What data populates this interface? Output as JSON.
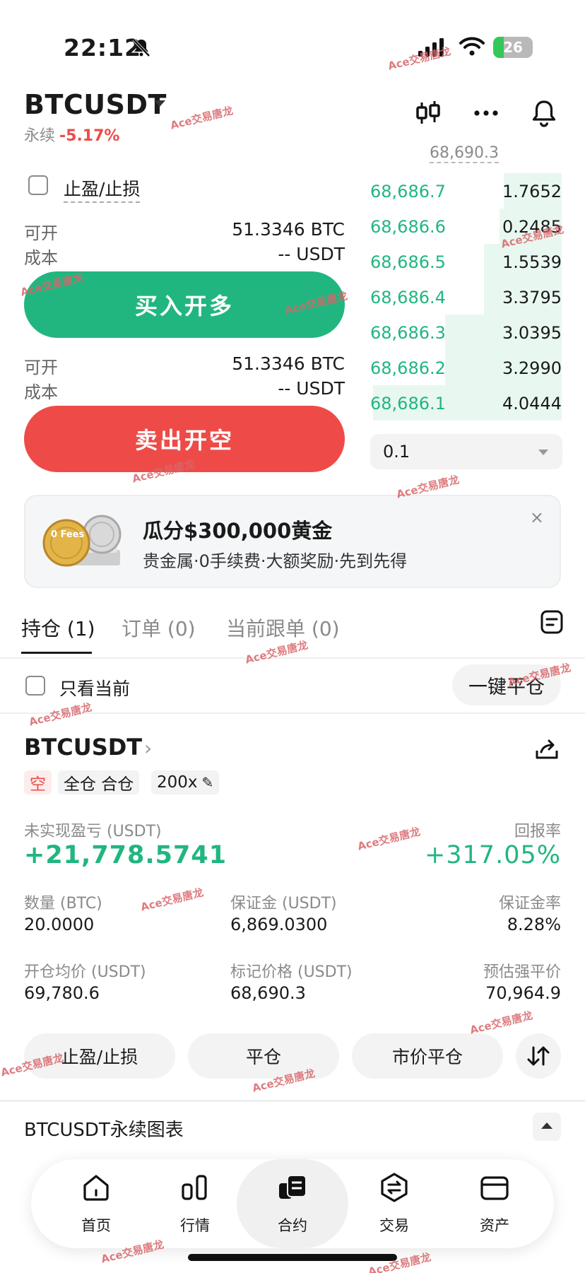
{
  "status_bar": {
    "time": "22:12",
    "battery": "26",
    "battery_level": 0.26
  },
  "header": {
    "symbol": "BTCUSDT",
    "contract_type": "永续",
    "change": "-5.17%",
    "last_price": "68,690.3"
  },
  "left_panel": {
    "tpsl_label": "止盈/止损",
    "long": {
      "avail_label": "可开",
      "avail_value": "51.3346 BTC",
      "cost_label": "成本",
      "cost_value": "-- USDT",
      "button": "买入开多"
    },
    "short": {
      "avail_label": "可开",
      "avail_value": "51.3346 BTC",
      "cost_label": "成本",
      "cost_value": "-- USDT",
      "button": "卖出开空"
    }
  },
  "order_book": {
    "rows": [
      {
        "price": "68,686.7",
        "qty": "1.7652"
      },
      {
        "price": "68,686.6",
        "qty": "0.2485"
      },
      {
        "price": "68,686.5",
        "qty": "1.5539"
      },
      {
        "price": "68,686.4",
        "qty": "3.3795"
      },
      {
        "price": "68,686.3",
        "qty": "3.0395"
      },
      {
        "price": "68,686.2",
        "qty": "3.2990"
      },
      {
        "price": "68,686.1",
        "qty": "4.0444"
      }
    ],
    "depth_fill": [
      0.3,
      0.32,
      0.4,
      0.4,
      0.6,
      0.6,
      0.97
    ],
    "step": "0.1"
  },
  "banner": {
    "title": "瓜分$300,000黄金",
    "subtitle": "贵金属·0手续费·大额奖励·先到先得",
    "close": "×",
    "coin_text": "0 Fees"
  },
  "tabs": [
    {
      "label": "持仓 (1)"
    },
    {
      "label": "订单 (0)"
    },
    {
      "label": "当前跟单 (0)"
    }
  ],
  "filter": {
    "only_current": "只看当前",
    "close_all": "一键平仓"
  },
  "position": {
    "symbol": "BTCUSDT",
    "side": "空",
    "margin_mode": "全仓 合仓",
    "leverage": "200x",
    "unrealized_label": "未实现盈亏 (USDT)",
    "unrealized_value": "+21,778.5741",
    "roe_label": "回报率",
    "roe_value": "+317.05%",
    "qty_label": "数量 (BTC)",
    "qty_value": "20.0000",
    "margin_label": "保证金 (USDT)",
    "margin_value": "6,869.0300",
    "margin_ratio_label": "保证金率",
    "margin_ratio_value": "8.28%",
    "entry_label": "开仓均价 (USDT)",
    "entry_value": "69,780.6",
    "mark_label": "标记价格 (USDT)",
    "mark_value": "68,690.3",
    "liq_label": "预估强平价",
    "liq_value": "70,964.9",
    "btn_tpsl": "止盈/止损",
    "btn_close": "平仓",
    "btn_market_close": "市价平仓"
  },
  "chart_section": {
    "title": "BTCUSDT永续图表"
  },
  "nav": [
    {
      "label": "首页",
      "icon": "home-icon"
    },
    {
      "label": "行情",
      "icon": "market-icon"
    },
    {
      "label": "合约",
      "icon": "futures-icon"
    },
    {
      "label": "交易",
      "icon": "trade-icon"
    },
    {
      "label": "资产",
      "icon": "wallet-icon"
    }
  ],
  "watermark": "Ace交易唐龙",
  "colors": {
    "green": "#21b67f",
    "red": "#ee4b48"
  }
}
